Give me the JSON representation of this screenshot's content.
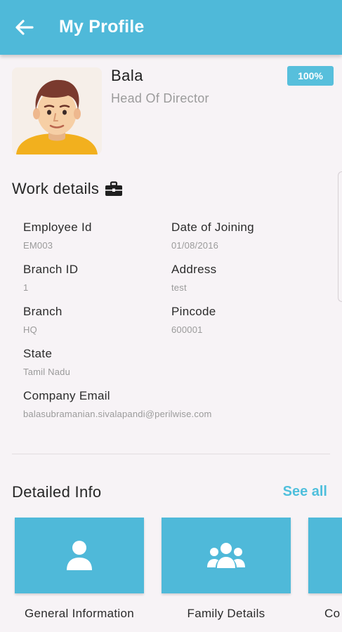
{
  "header": {
    "title": "My Profile",
    "back_icon": "arrow-left-icon"
  },
  "profile": {
    "name": "Bala",
    "role": "Head Of Director",
    "completion": "100%",
    "avatar_icon": "user-avatar-illustration"
  },
  "work": {
    "title": "Work details",
    "title_icon": "briefcase-icon",
    "fields": [
      {
        "label": "Employee Id",
        "value": "EM003"
      },
      {
        "label": "Date of Joining",
        "value": "01/08/2016"
      },
      {
        "label": "Branch ID",
        "value": "1"
      },
      {
        "label": "Address",
        "value": "test"
      },
      {
        "label": "Branch",
        "value": "HQ"
      },
      {
        "label": "Pincode",
        "value": "600001"
      },
      {
        "label": "State",
        "value": "Tamil Nadu"
      },
      {
        "label": "Company Email",
        "value": "balasubramanian.sivalapandi@perilwise.com"
      }
    ]
  },
  "detailed": {
    "title": "Detailed Info",
    "see_all": "See all",
    "cards": [
      {
        "label": "General Information",
        "icon": "person-icon"
      },
      {
        "label": "Family Details",
        "icon": "group-icon"
      },
      {
        "label": "Co",
        "icon": ""
      }
    ]
  },
  "colors": {
    "primary": "#4fb9d9",
    "accent": "#4fbfdc",
    "background": "#f7f3f6"
  }
}
